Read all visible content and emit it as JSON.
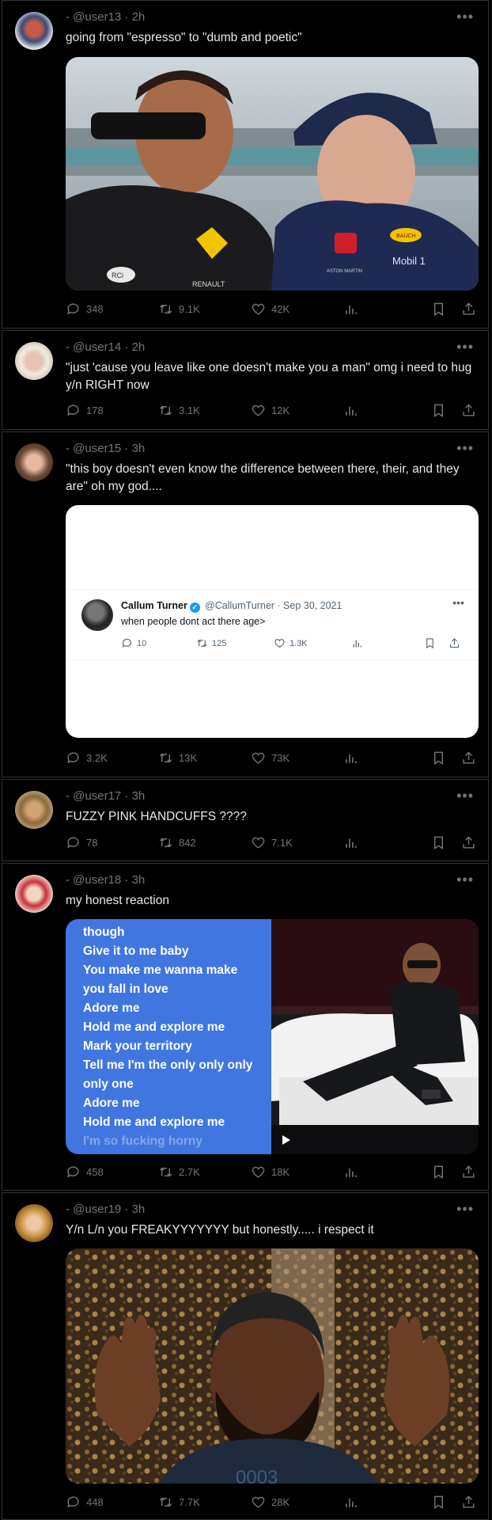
{
  "posts": [
    {
      "handle": "- @user13 · 2h",
      "text": "going from \"espresso\" to \"dumb and poetic\"",
      "replies": "348",
      "reposts": "9.1K",
      "likes": "42K"
    },
    {
      "handle": "- @user14 · 2h",
      "text": "\"just 'cause you leave like one doesn't make you a man\" omg i need to hug y/n RIGHT now",
      "replies": "178",
      "reposts": "3.1K",
      "likes": "12K"
    },
    {
      "handle": "- @user15 · 3h",
      "text": "\"this boy doesn't even know the difference between there, their, and they are\" oh my god....",
      "replies": "3.2K",
      "reposts": "13K",
      "likes": "73K"
    },
    {
      "handle": "- @user17 · 3h",
      "text": "FUZZY PINK HANDCUFFS ????",
      "replies": "78",
      "reposts": "842",
      "likes": "7.1K"
    },
    {
      "handle": "- @user18 · 3h",
      "text": "my honest reaction",
      "replies": "458",
      "reposts": "2.7K",
      "likes": "18K"
    },
    {
      "handle": "- @user19 · 3h",
      "text": "Y/n L/n you FREAKYYYYYYY but honestly..... i respect it",
      "replies": "448",
      "reposts": "7.7K",
      "likes": "28K"
    }
  ],
  "photo1": {
    "left_wordmark": "RENAULT",
    "left_sponsor": "RCi",
    "right_sponsor": "Mobil 1",
    "right_small": "ASTON MARTIN",
    "right_badge": "BAUCH"
  },
  "embed": {
    "name": "Callum Turner",
    "meta": "@CallumTurner · Sep 30, 2021",
    "text": "when people dont act there age>",
    "replies": "10",
    "reposts": "125",
    "likes": "1.3K"
  },
  "lyrics": [
    "though",
    "Give it to me baby",
    "You make me wanna make",
    "you fall in love",
    "Adore me",
    "Hold me and explore me",
    "Mark your territory",
    "Tell me I'm the only only only",
    "only one",
    "Adore me",
    "Hold me and explore me",
    "I'm so fucking horny"
  ],
  "colors": {
    "background": "#000000",
    "border": "#2f3336",
    "text": "#e7e9ea",
    "muted": "#71767b",
    "lyrics_bg": "#4176e0"
  },
  "icons": [
    "reply-icon",
    "repost-icon",
    "like-icon",
    "views-icon",
    "bookmark-icon",
    "share-icon",
    "more-icon",
    "verified-icon"
  ]
}
